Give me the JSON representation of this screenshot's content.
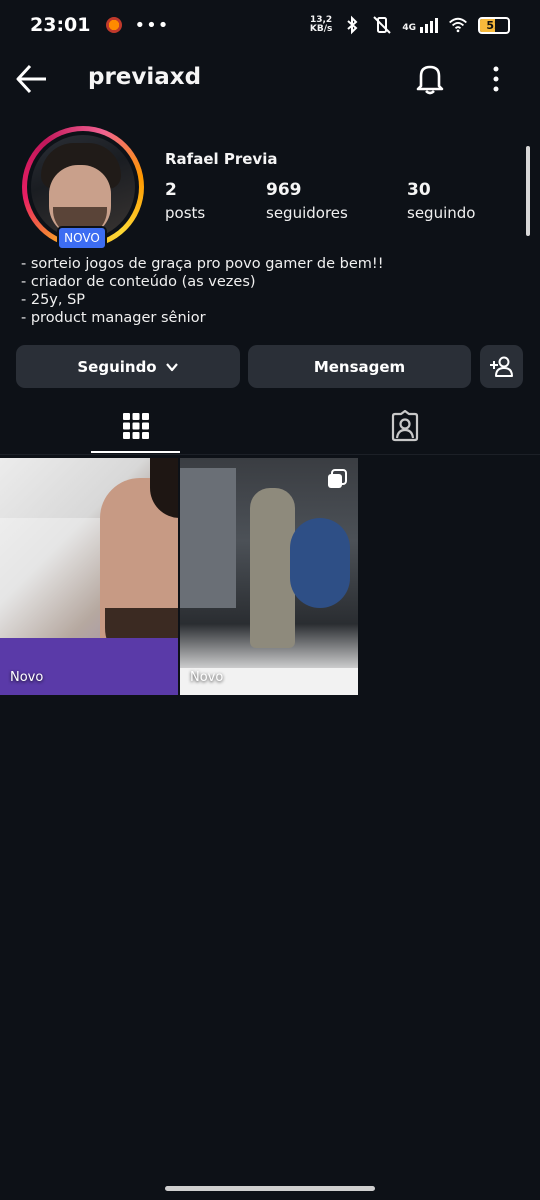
{
  "status_bar": {
    "time": "23:01",
    "dots": "•••",
    "net_speed_value": "13,2",
    "net_speed_unit": "KB/s",
    "network": "4G",
    "battery_level": "52",
    "battery_color": "#f7b93b"
  },
  "app_bar": {
    "username": "previaxd",
    "back_icon": "arrow-left-icon",
    "bell_icon": "bell-icon",
    "more_icon": "more-vertical-icon"
  },
  "profile": {
    "display_name": "Rafael Previa",
    "new_badge": "NOVO",
    "stats": [
      {
        "value": "2",
        "label": "posts"
      },
      {
        "value": "969",
        "label": "seguidores"
      },
      {
        "value": "30",
        "label": "seguindo"
      }
    ],
    "bio": [
      "- sorteio jogos de graça pro povo gamer de bem!!",
      "- criador de conteúdo (as vezes)",
      "- 25y, SP",
      "- product manager sênior"
    ]
  },
  "actions": {
    "following_label": "Seguindo",
    "message_label": "Mensagem",
    "add_person_icon": "add-person-icon"
  },
  "tabs": [
    {
      "icon": "grid-icon",
      "active": true
    },
    {
      "icon": "tagged-person-icon",
      "active": false
    }
  ],
  "posts": [
    {
      "label": "Novo",
      "multi": false
    },
    {
      "label": "Novo",
      "multi": true
    }
  ],
  "colors": {
    "background": "#0d1117",
    "button_bg": "#2a2f37",
    "badge_blue": "#3d6df2"
  }
}
